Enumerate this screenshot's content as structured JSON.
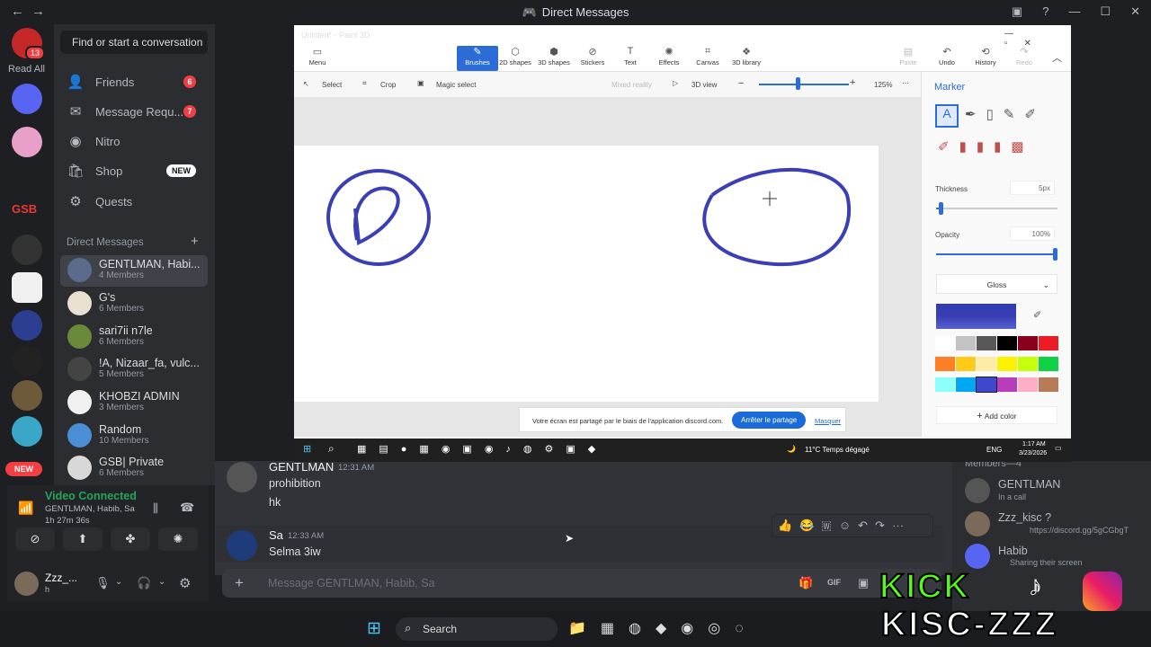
{
  "window": {
    "title": "Direct Messages"
  },
  "rail": {
    "read_all": "Read All",
    "badge": "13",
    "new_label": "NEW",
    "gsb": "GSB"
  },
  "dm_sidebar": {
    "search_placeholder": "Find or start a conversation",
    "nav": [
      {
        "label": "Friends",
        "badge": "6",
        "icon": "friends-icon"
      },
      {
        "label": "Message Requ...",
        "badge": "7",
        "icon": "envelope-icon"
      },
      {
        "label": "Nitro",
        "icon": "nitro-icon"
      },
      {
        "label": "Shop",
        "badge": "NEW",
        "icon": "shop-icon"
      },
      {
        "label": "Quests",
        "icon": "quests-icon"
      }
    ],
    "section_title": "Direct Messages",
    "dms": [
      {
        "name": "GENTLMAN, Habi...",
        "sub": "4 Members"
      },
      {
        "name": "G's",
        "sub": "6 Members"
      },
      {
        "name": "sari7ii n7le",
        "sub": "6 Members"
      },
      {
        "name": "!A, Nizaar_fa, vulc...",
        "sub": "5 Members"
      },
      {
        "name": "KHOBZI ADMIN",
        "sub": "3 Members"
      },
      {
        "name": "Random",
        "sub": "10 Members"
      },
      {
        "name": "GSB| Private",
        "sub": "6 Members"
      }
    ]
  },
  "voice": {
    "status": "Video Connected",
    "channel": "GENTLMAN, Habib, Sa",
    "timer": "1h  27m  36s"
  },
  "user": {
    "name": "Zzz_...",
    "status": "h"
  },
  "chat": {
    "messages": [
      {
        "author": "GENTLMAN",
        "time": "12:31 AM",
        "lines": [
          "prohibition",
          "hk"
        ]
      },
      {
        "author": "Sa",
        "time": "12:33 AM",
        "lines": [
          "Selma 3iw"
        ]
      }
    ],
    "composer_placeholder": "Message GENTLMAN, Habib, Sa"
  },
  "members": {
    "header": "Members—4",
    "list": [
      {
        "name": "GENTLMAN",
        "status": "In a call"
      },
      {
        "name": "Zzz_kisc ?",
        "status": "https://discord.gg/5gCGbgT"
      },
      {
        "name": "Habib",
        "status": "Sharing their screen"
      }
    ]
  },
  "paint3d": {
    "title": "Untitled* - Paint 3D",
    "menu": "Menu",
    "tools": [
      "Brushes",
      "2D shapes",
      "3D shapes",
      "Stickers",
      "Text",
      "Effects",
      "Canvas",
      "3D library"
    ],
    "right_tools": [
      "Paste",
      "Undo",
      "History",
      "Redo"
    ],
    "subbar": {
      "select": "Select",
      "crop": "Crop",
      "magic": "Magic select",
      "mixed": "Mixed reality",
      "view3d": "3D view",
      "zoom": "125%"
    },
    "panel": {
      "title": "Marker",
      "thickness_label": "Thickness",
      "thickness_value": "5px",
      "opacity_label": "Opacity",
      "opacity_value": "100%",
      "finish": "Gloss",
      "add_color": "Add color"
    },
    "share_bar": {
      "text": "Votre écran est partagé par le biais de l'application discord.com.",
      "stop": "Arrêter le partage",
      "hide": "Masquer"
    },
    "tray": {
      "weather": "11°C  Temps dégagé",
      "lang": "ENG",
      "time": "1:17 AM",
      "date": "3/23/2026"
    },
    "ink_color": "#3b3fb5"
  },
  "taskbar": {
    "search": "Search"
  },
  "overlay": {
    "text": "KISC-ZZZ",
    "brand": "KICK"
  }
}
